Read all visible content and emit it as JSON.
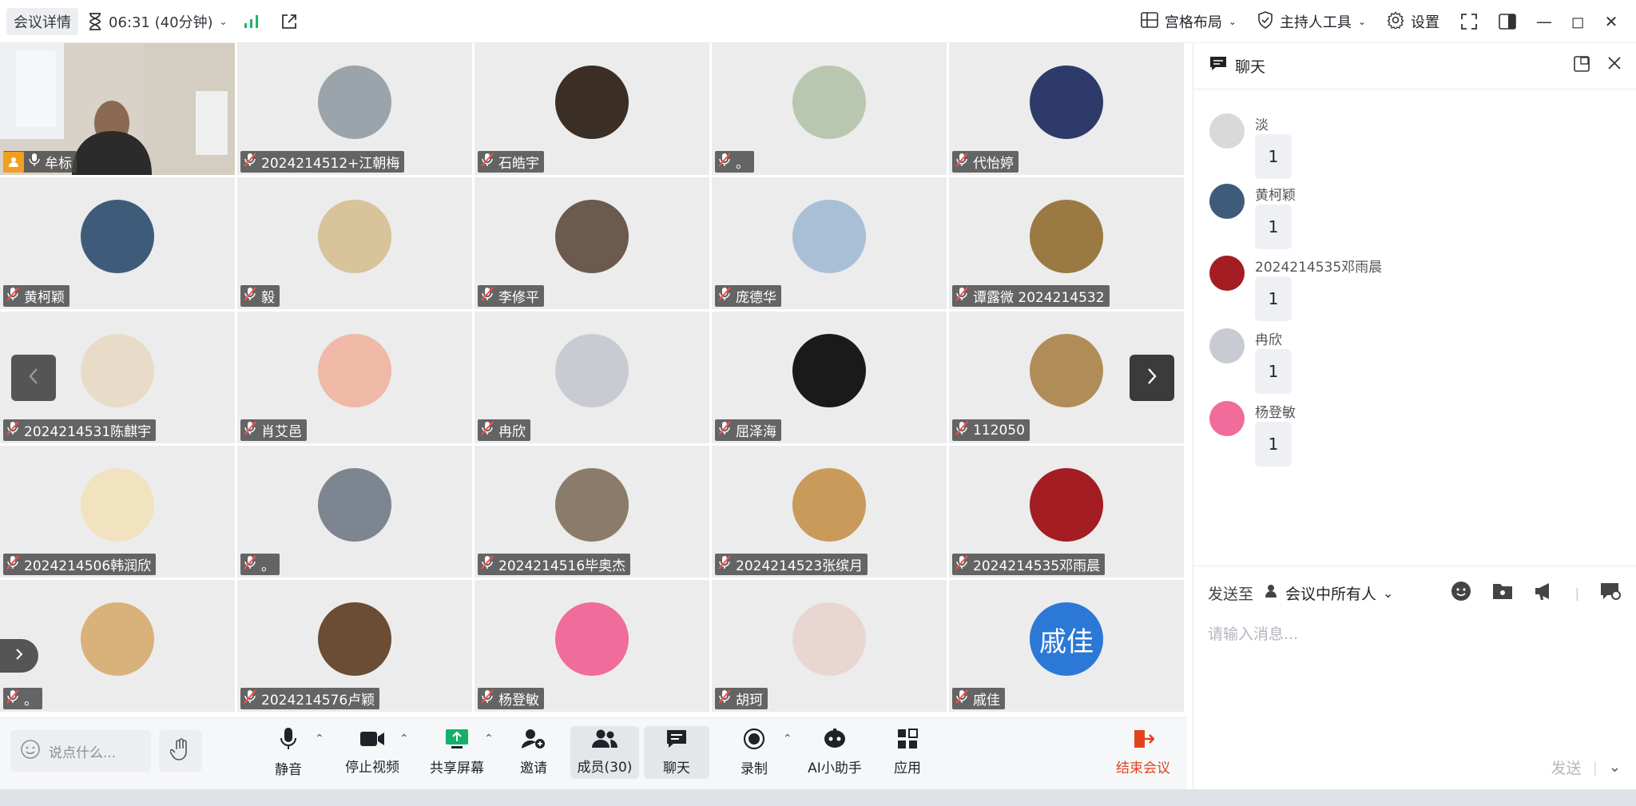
{
  "topbar": {
    "meeting_detail": "会议详情",
    "timer": "06:31 (40分钟)",
    "layout": "宫格布局",
    "host_tools": "主持人工具",
    "settings": "设置"
  },
  "tiles": [
    {
      "name": "牟标",
      "self": true
    },
    {
      "name": "2024214512+江朝梅",
      "avatar_color": "#9aa4aa"
    },
    {
      "name": "石皓宇",
      "avatar_color": "#3a2e25"
    },
    {
      "name": "。",
      "avatar_color": "#b9c7b0"
    },
    {
      "name": "代怡婷",
      "avatar_color": "#2d3a6a"
    },
    {
      "name": "黄柯颖",
      "avatar_color": "#3e5c7a"
    },
    {
      "name": "毅",
      "avatar_color": "#d8c39a"
    },
    {
      "name": "李修平",
      "avatar_color": "#6b5a4d"
    },
    {
      "name": "庞德华",
      "avatar_color": "#a9bfd6"
    },
    {
      "name": "谭露微 2024214532",
      "avatar_color": "#9a7a42"
    },
    {
      "name": "2024214531陈麒宇",
      "avatar_color": "#e8dcc8"
    },
    {
      "name": "肖艾邑",
      "avatar_color": "#f0b8a6"
    },
    {
      "name": "冉欣",
      "avatar_color": "#c8ccd2"
    },
    {
      "name": "屈泽海",
      "avatar_color": "#1a1a1a"
    },
    {
      "name": "112050",
      "avatar_color": "#b08d58"
    },
    {
      "name": "2024214506韩润欣",
      "avatar_color": "#f1e2c0"
    },
    {
      "name": "。",
      "avatar_color": "#7c8590"
    },
    {
      "name": "2024214516毕奥杰",
      "avatar_color": "#8a7b6a"
    },
    {
      "name": "2024214523张缤月",
      "avatar_color": "#c99a5a"
    },
    {
      "name": "2024214535邓雨晨",
      "avatar_color": "#a41d22"
    },
    {
      "name": "。",
      "avatar_color": "#d8b27a"
    },
    {
      "name": "2024214576卢颖",
      "avatar_color": "#6a4d34"
    },
    {
      "name": "杨登敏",
      "avatar_color": "#f06c9b"
    },
    {
      "name": "胡珂",
      "avatar_color": "#e9d6d2"
    },
    {
      "name": "戚佳",
      "avatar_color": "#2b78d6",
      "avatar_text": "戚佳"
    }
  ],
  "toolbar": {
    "say_placeholder": "说点什么...",
    "mute": "静音",
    "stop_video": "停止视频",
    "share_screen": "共享屏幕",
    "invite": "邀请",
    "members": "成员(30)",
    "chat": "聊天",
    "record": "录制",
    "ai_assistant": "AI小助手",
    "apps": "应用",
    "end_meeting": "结束会议"
  },
  "chat": {
    "title": "聊天",
    "messages": [
      {
        "name": "淡",
        "text": "1",
        "avatar_color": "#d9d9d9"
      },
      {
        "name": "黄柯颖",
        "text": "1",
        "avatar_color": "#3e5c7a"
      },
      {
        "name": "2024214535邓雨晨",
        "text": "1",
        "avatar_color": "#a41d22"
      },
      {
        "name": "冉欣",
        "text": "1",
        "avatar_color": "#c8ccd2"
      },
      {
        "name": "杨登敏",
        "text": "1",
        "avatar_color": "#f06c9b"
      }
    ],
    "send_to_label": "发送至",
    "send_target": "会议中所有人",
    "input_placeholder": "请输入消息...",
    "send_label": "发送"
  }
}
